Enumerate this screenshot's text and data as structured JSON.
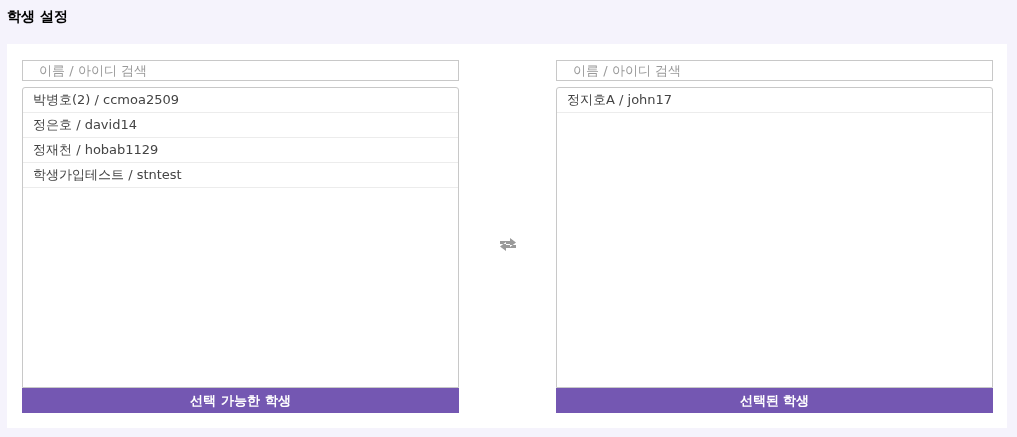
{
  "title": "학생 설정",
  "panels": [
    {
      "search": {
        "placeholder": "이름 / 아이디 검색"
      },
      "items": [
        "박병호(2) / ccmoa2509",
        "정은호 / david14",
        "정재천 / hobab1129",
        "학생가입테스트 / stntest"
      ],
      "footer": "선택 가능한 학생"
    },
    {
      "search": {
        "placeholder": "이름 / 아이디 검색"
      },
      "items": [
        "정지호A / john17"
      ],
      "footer": "선택된 학생"
    }
  ]
}
